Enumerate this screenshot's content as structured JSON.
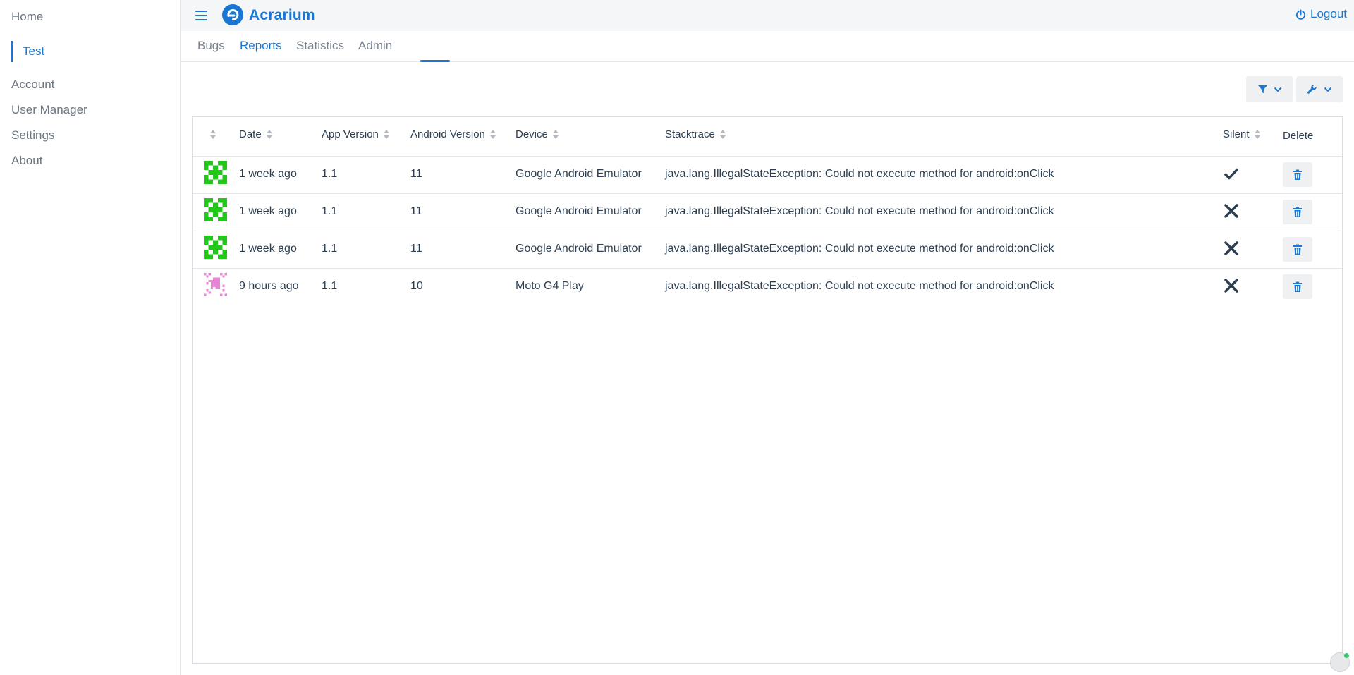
{
  "sidebar": {
    "items": [
      {
        "label": "Home"
      },
      {
        "label": "Test"
      },
      {
        "label": "Account"
      },
      {
        "label": "User Manager"
      },
      {
        "label": "Settings"
      },
      {
        "label": "About"
      }
    ]
  },
  "header": {
    "brand": "Acrarium",
    "logout_label": "Logout",
    "accent_color": "#1976d2"
  },
  "tabs": [
    {
      "label": "Bugs",
      "active": false
    },
    {
      "label": "Reports",
      "active": true
    },
    {
      "label": "Statistics",
      "active": false
    },
    {
      "label": "Admin",
      "active": false
    }
  ],
  "toolbar": {
    "filter_icon": "filter-icon",
    "tools_icon": "wrench-icon"
  },
  "table": {
    "headers": {
      "date": "Date",
      "app_version": "App Version",
      "android_version": "Android Version",
      "device": "Device",
      "stacktrace": "Stacktrace",
      "silent": "Silent",
      "delete": "Delete"
    },
    "rows": [
      {
        "avatar": "green-identicon",
        "date": "1 week ago",
        "app_version": "1.1",
        "android_version": "11",
        "device": "Google Android Emulator",
        "stacktrace": "java.lang.IllegalStateException: Could not execute method for android:onClick",
        "silent": true
      },
      {
        "avatar": "green-identicon",
        "date": "1 week ago",
        "app_version": "1.1",
        "android_version": "11",
        "device": "Google Android Emulator",
        "stacktrace": "java.lang.IllegalStateException: Could not execute method for android:onClick",
        "silent": false
      },
      {
        "avatar": "green-identicon",
        "date": "1 week ago",
        "app_version": "1.1",
        "android_version": "11",
        "device": "Google Android Emulator",
        "stacktrace": "java.lang.IllegalStateException: Could not execute method for android:onClick",
        "silent": false
      },
      {
        "avatar": "pink-identicon",
        "date": "9 hours ago",
        "app_version": "1.1",
        "android_version": "10",
        "device": "Moto G4 Play",
        "stacktrace": "java.lang.IllegalStateException: Could not execute method for android:onClick",
        "silent": false
      }
    ]
  }
}
